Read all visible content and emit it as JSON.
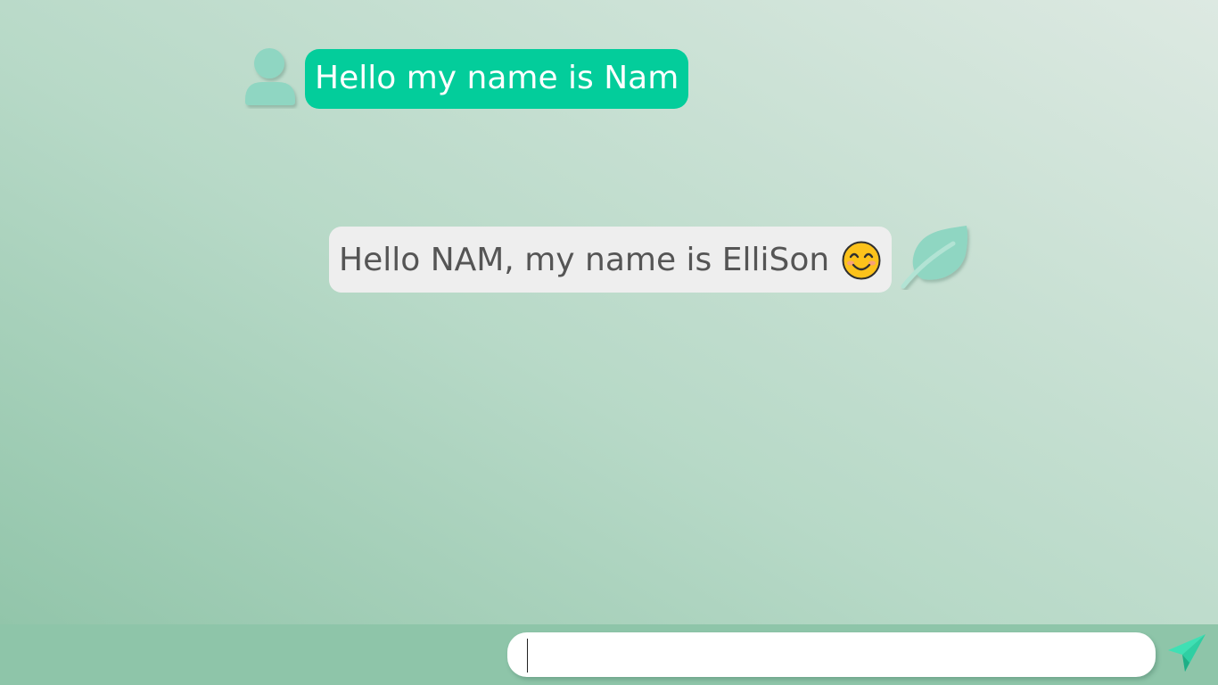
{
  "messages": [
    {
      "sender": "user",
      "text": "Hello my name is Nam",
      "avatar_icon": "user-silhouette-icon"
    },
    {
      "sender": "bot",
      "text": "Hello NAM, my name is ElliSon",
      "emoji_icon": "smiling-face-icon",
      "avatar_icon": "leaf-icon"
    }
  ],
  "composer": {
    "value": "",
    "placeholder": "",
    "send_icon": "paper-plane-send-icon"
  },
  "colors": {
    "user_bubble": "#03cd9b",
    "bot_bubble": "#eeeeee",
    "bot_text": "#555555",
    "avatar": "#8fd6c2",
    "send_icon": "#3fe0b4",
    "input_bar": "#8ec5a9"
  }
}
